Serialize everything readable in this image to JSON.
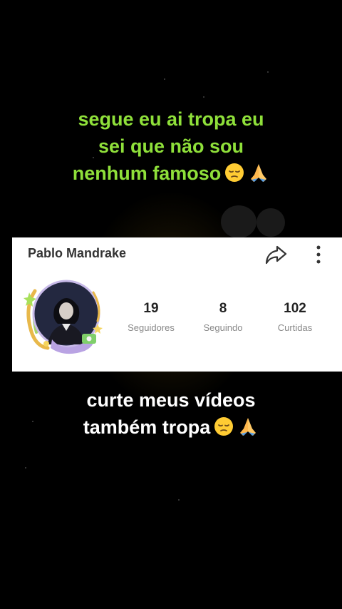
{
  "caption_top": {
    "line1": "segue eu ai tropa eu",
    "line2": "sei que não sou",
    "line3": "nenhum famoso"
  },
  "caption_bottom": {
    "line1": "curte meus vídeos",
    "line2": "também tropa"
  },
  "profile": {
    "name": "Pablo Mandrake",
    "stats": [
      {
        "value": "19",
        "label": "Seguidores"
      },
      {
        "value": "8",
        "label": "Seguindo"
      },
      {
        "value": "102",
        "label": "Curtidas"
      }
    ]
  },
  "icons": {
    "share": "share-arrow-icon",
    "more": "more-vertical-icon",
    "emojis": [
      "pensive-face-icon",
      "folded-hands-icon"
    ]
  },
  "colors": {
    "background": "#000000",
    "caption_top": "#8fe03a",
    "caption_bottom": "#ffffff",
    "card": "#ffffff"
  }
}
